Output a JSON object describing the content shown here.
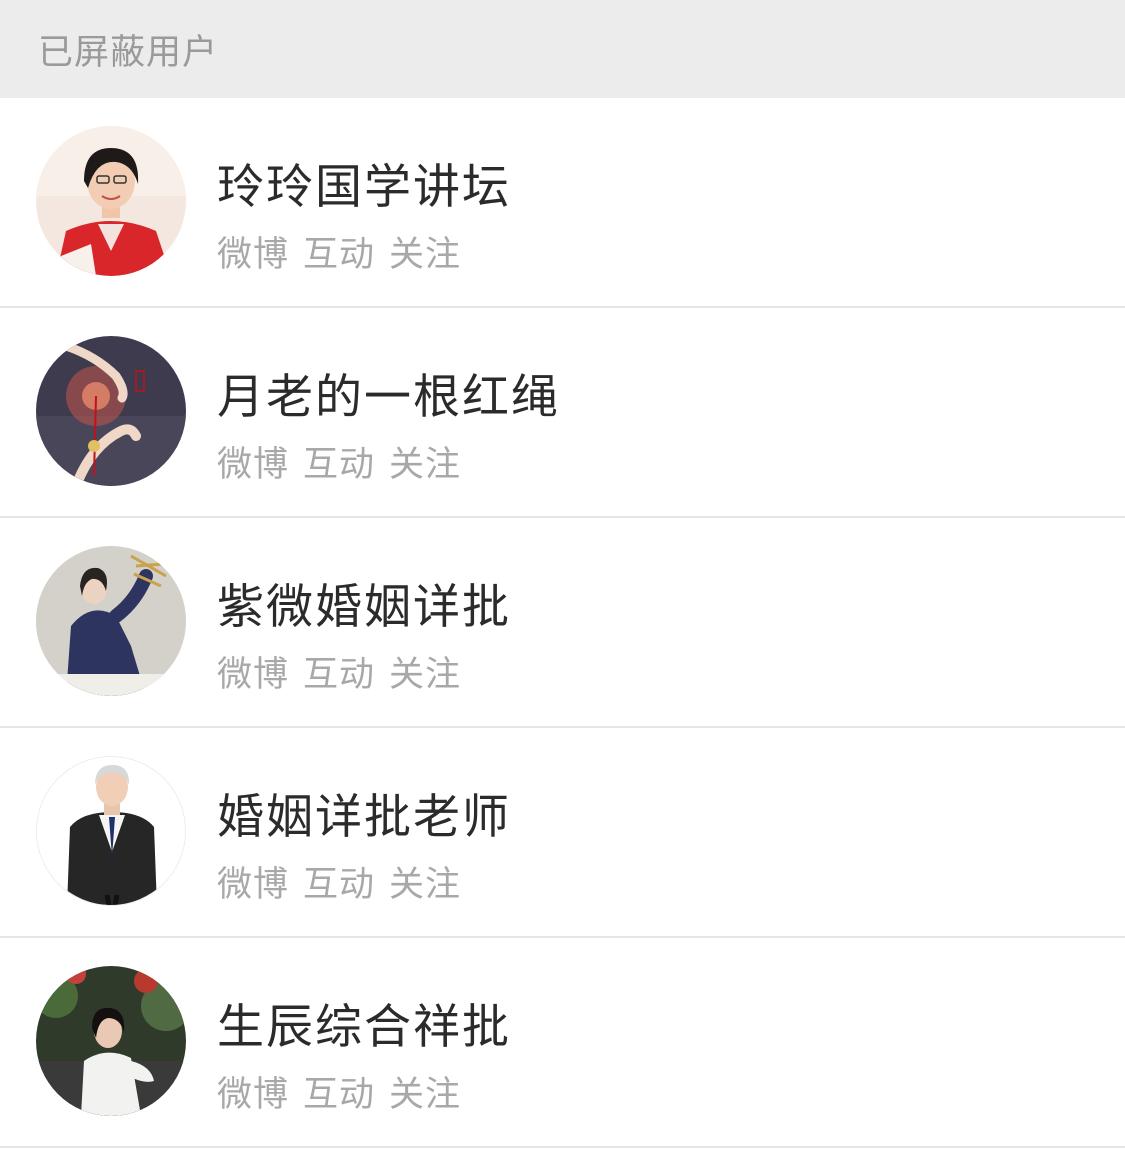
{
  "header": {
    "title": "已屏蔽用户"
  },
  "users": [
    {
      "name": "玲玲国学讲坛",
      "actions": [
        "微博",
        "互动",
        "关注"
      ],
      "avatar_icon": "woman-red-blazer-avatar"
    },
    {
      "name": "月老的一根红绳",
      "actions": [
        "微博",
        "互动",
        "关注"
      ],
      "avatar_icon": "red-string-hands-avatar"
    },
    {
      "name": "紫微婚姻详批",
      "actions": [
        "微博",
        "互动",
        "关注"
      ],
      "avatar_icon": "woman-navy-robe-avatar"
    },
    {
      "name": "婚姻详批老师",
      "actions": [
        "微博",
        "互动",
        "关注"
      ],
      "avatar_icon": "man-dark-suit-avatar"
    },
    {
      "name": "生辰综合祥批",
      "actions": [
        "微博",
        "互动",
        "关注"
      ],
      "avatar_icon": "woman-white-dress-avatar"
    }
  ]
}
